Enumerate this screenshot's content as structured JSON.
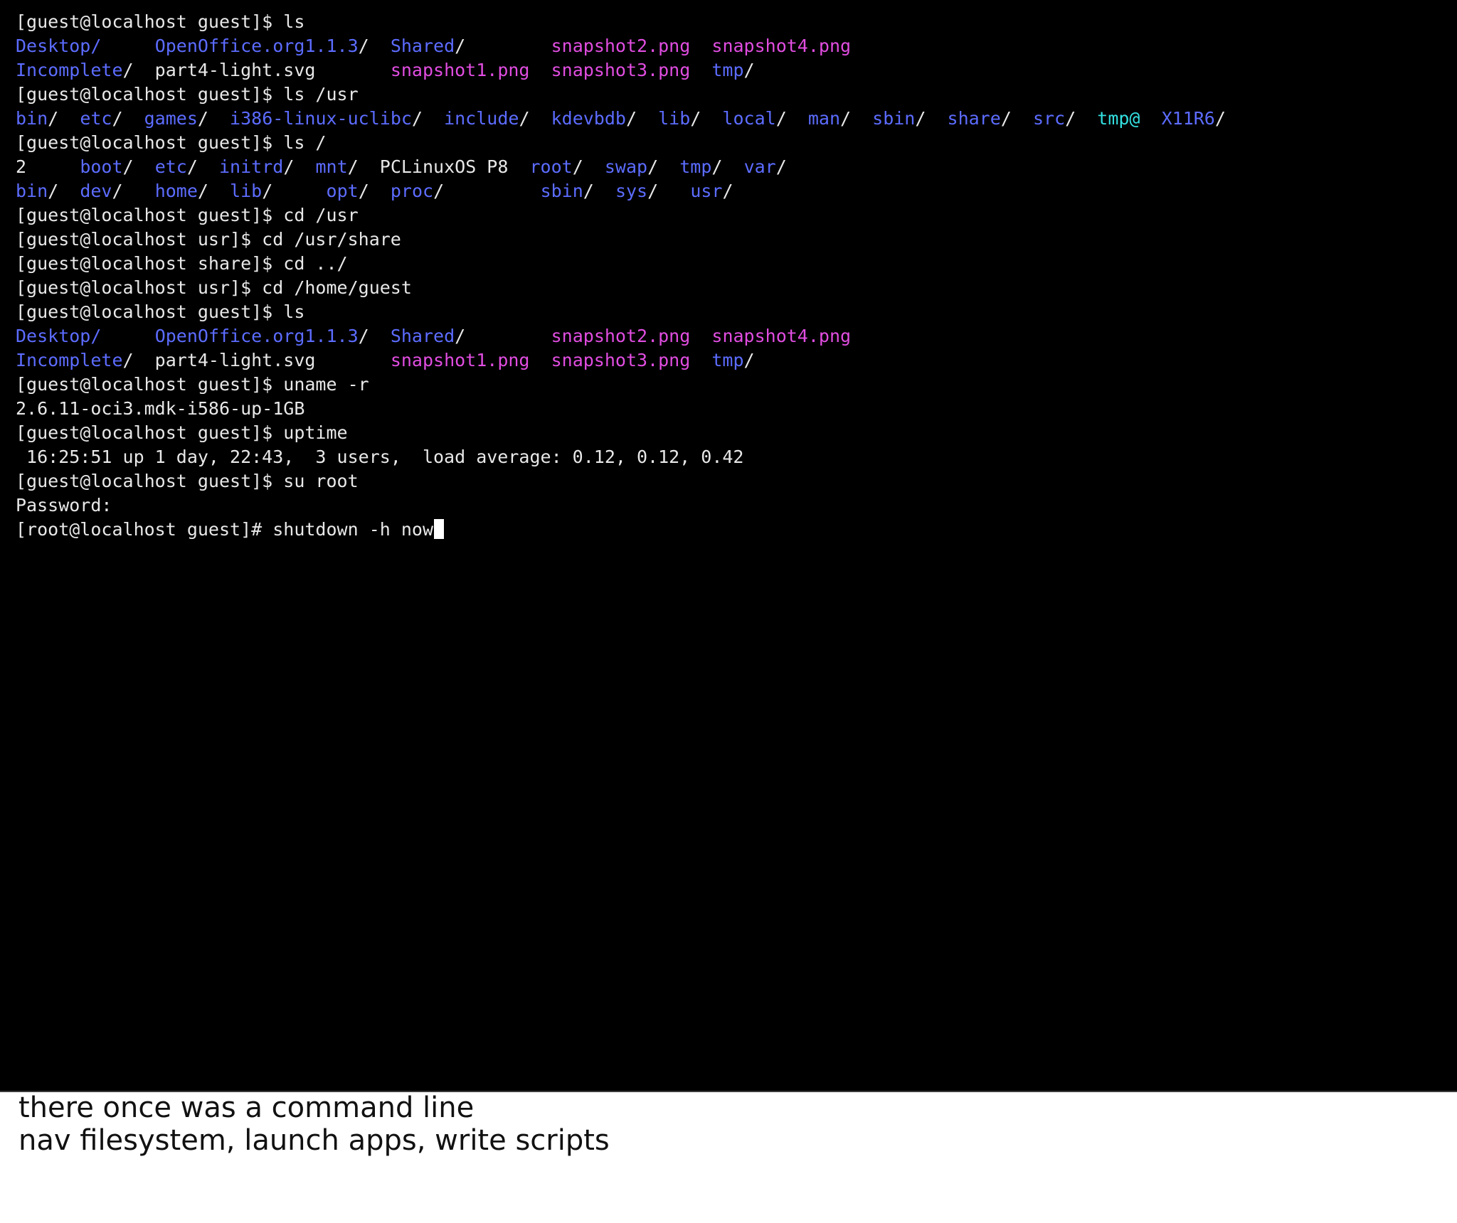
{
  "terminal": {
    "colors": {
      "background": "#000000",
      "text": "#e8e8e8",
      "directory": "#5c6cff",
      "image_file": "#e14de1",
      "symlink": "#33e0e0",
      "cursor": "#ffffff"
    },
    "lines": [
      [
        {
          "t": "[guest@localhost guest]$ ls",
          "c": "white"
        }
      ],
      [
        {
          "t": "Desktop/",
          "c": "blue"
        },
        {
          "t": "     ",
          "c": "white"
        },
        {
          "t": "OpenOffice.org1.1.3",
          "c": "blue"
        },
        {
          "t": "/  ",
          "c": "white"
        },
        {
          "t": "Shared",
          "c": "blue"
        },
        {
          "t": "/        ",
          "c": "white"
        },
        {
          "t": "snapshot2.png",
          "c": "magenta"
        },
        {
          "t": "  ",
          "c": "white"
        },
        {
          "t": "snapshot4.png",
          "c": "magenta"
        }
      ],
      [
        {
          "t": "Incomplete",
          "c": "blue"
        },
        {
          "t": "/  part4-light.svg       ",
          "c": "white"
        },
        {
          "t": "snapshot1.png",
          "c": "magenta"
        },
        {
          "t": "  ",
          "c": "white"
        },
        {
          "t": "snapshot3.png",
          "c": "magenta"
        },
        {
          "t": "  ",
          "c": "white"
        },
        {
          "t": "tmp",
          "c": "blue"
        },
        {
          "t": "/",
          "c": "white"
        }
      ],
      [
        {
          "t": "[guest@localhost guest]$ ls /usr",
          "c": "white"
        }
      ],
      [
        {
          "t": "bin",
          "c": "blue"
        },
        {
          "t": "/  ",
          "c": "white"
        },
        {
          "t": "etc",
          "c": "blue"
        },
        {
          "t": "/  ",
          "c": "white"
        },
        {
          "t": "games",
          "c": "blue"
        },
        {
          "t": "/  ",
          "c": "white"
        },
        {
          "t": "i386-linux-uclibc",
          "c": "blue"
        },
        {
          "t": "/  ",
          "c": "white"
        },
        {
          "t": "include",
          "c": "blue"
        },
        {
          "t": "/  ",
          "c": "white"
        },
        {
          "t": "kdevbdb",
          "c": "blue"
        },
        {
          "t": "/  ",
          "c": "white"
        },
        {
          "t": "lib",
          "c": "blue"
        },
        {
          "t": "/  ",
          "c": "white"
        },
        {
          "t": "local",
          "c": "blue"
        },
        {
          "t": "/  ",
          "c": "white"
        },
        {
          "t": "man",
          "c": "blue"
        },
        {
          "t": "/  ",
          "c": "white"
        },
        {
          "t": "sbin",
          "c": "blue"
        },
        {
          "t": "/  ",
          "c": "white"
        },
        {
          "t": "share",
          "c": "blue"
        },
        {
          "t": "/  ",
          "c": "white"
        },
        {
          "t": "src",
          "c": "blue"
        },
        {
          "t": "/  ",
          "c": "white"
        },
        {
          "t": "tmp@",
          "c": "cyan"
        },
        {
          "t": "  ",
          "c": "white"
        },
        {
          "t": "X11R6",
          "c": "blue"
        },
        {
          "t": "/",
          "c": "white"
        }
      ],
      [
        {
          "t": "[guest@localhost guest]$ ls /",
          "c": "white"
        }
      ],
      [
        {
          "t": "2     ",
          "c": "white"
        },
        {
          "t": "boot",
          "c": "blue"
        },
        {
          "t": "/  ",
          "c": "white"
        },
        {
          "t": "etc",
          "c": "blue"
        },
        {
          "t": "/  ",
          "c": "white"
        },
        {
          "t": "initrd",
          "c": "blue"
        },
        {
          "t": "/  ",
          "c": "white"
        },
        {
          "t": "mnt",
          "c": "blue"
        },
        {
          "t": "/  PCLinuxOS P8  ",
          "c": "white"
        },
        {
          "t": "root",
          "c": "blue"
        },
        {
          "t": "/  ",
          "c": "white"
        },
        {
          "t": "swap",
          "c": "blue"
        },
        {
          "t": "/  ",
          "c": "white"
        },
        {
          "t": "tmp",
          "c": "blue"
        },
        {
          "t": "/  ",
          "c": "white"
        },
        {
          "t": "var",
          "c": "blue"
        },
        {
          "t": "/",
          "c": "white"
        }
      ],
      [
        {
          "t": "bin",
          "c": "blue"
        },
        {
          "t": "/  ",
          "c": "white"
        },
        {
          "t": "dev",
          "c": "blue"
        },
        {
          "t": "/   ",
          "c": "white"
        },
        {
          "t": "home",
          "c": "blue"
        },
        {
          "t": "/  ",
          "c": "white"
        },
        {
          "t": "lib",
          "c": "blue"
        },
        {
          "t": "/     ",
          "c": "white"
        },
        {
          "t": "opt",
          "c": "blue"
        },
        {
          "t": "/  ",
          "c": "white"
        },
        {
          "t": "proc",
          "c": "blue"
        },
        {
          "t": "/         ",
          "c": "white"
        },
        {
          "t": "sbin",
          "c": "blue"
        },
        {
          "t": "/  ",
          "c": "white"
        },
        {
          "t": "sys",
          "c": "blue"
        },
        {
          "t": "/   ",
          "c": "white"
        },
        {
          "t": "usr",
          "c": "blue"
        },
        {
          "t": "/",
          "c": "white"
        }
      ],
      [
        {
          "t": "[guest@localhost guest]$ cd /usr",
          "c": "white"
        }
      ],
      [
        {
          "t": "[guest@localhost usr]$ cd /usr/share",
          "c": "white"
        }
      ],
      [
        {
          "t": "[guest@localhost share]$ cd ../",
          "c": "white"
        }
      ],
      [
        {
          "t": "[guest@localhost usr]$ cd /home/guest",
          "c": "white"
        }
      ],
      [
        {
          "t": "[guest@localhost guest]$ ls",
          "c": "white"
        }
      ],
      [
        {
          "t": "Desktop/",
          "c": "blue"
        },
        {
          "t": "     ",
          "c": "white"
        },
        {
          "t": "OpenOffice.org1.1.3",
          "c": "blue"
        },
        {
          "t": "/  ",
          "c": "white"
        },
        {
          "t": "Shared",
          "c": "blue"
        },
        {
          "t": "/        ",
          "c": "white"
        },
        {
          "t": "snapshot2.png",
          "c": "magenta"
        },
        {
          "t": "  ",
          "c": "white"
        },
        {
          "t": "snapshot4.png",
          "c": "magenta"
        }
      ],
      [
        {
          "t": "Incomplete",
          "c": "blue"
        },
        {
          "t": "/  part4-light.svg       ",
          "c": "white"
        },
        {
          "t": "snapshot1.png",
          "c": "magenta"
        },
        {
          "t": "  ",
          "c": "white"
        },
        {
          "t": "snapshot3.png",
          "c": "magenta"
        },
        {
          "t": "  ",
          "c": "white"
        },
        {
          "t": "tmp",
          "c": "blue"
        },
        {
          "t": "/",
          "c": "white"
        }
      ],
      [
        {
          "t": "[guest@localhost guest]$ uname -r",
          "c": "white"
        }
      ],
      [
        {
          "t": "2.6.11-oci3.mdk-i586-up-1GB",
          "c": "white"
        }
      ],
      [
        {
          "t": "[guest@localhost guest]$ uptime",
          "c": "white"
        }
      ],
      [
        {
          "t": " 16:25:51 up 1 day, 22:43,  3 users,  load average: 0.12, 0.12, 0.42",
          "c": "white"
        }
      ],
      [
        {
          "t": "[guest@localhost guest]$ su root",
          "c": "white"
        }
      ],
      [
        {
          "t": "Password:",
          "c": "white"
        }
      ],
      [
        {
          "t": "[root@localhost guest]# shutdown -h now",
          "c": "white"
        }
      ]
    ]
  },
  "caption": {
    "line1": "there once was a command line",
    "line2": "nav filesystem, launch apps, write scripts"
  }
}
